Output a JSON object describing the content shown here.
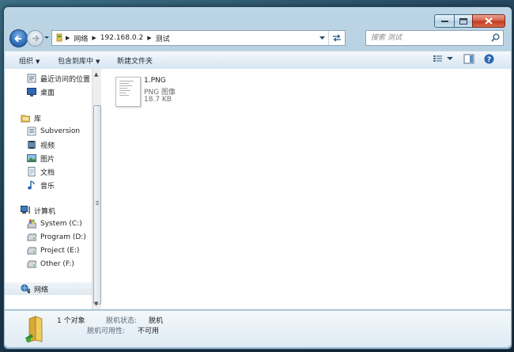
{
  "window": {
    "caption": {
      "minimize": "minimize",
      "maximize": "maximize",
      "close": "close"
    }
  },
  "address": {
    "crumbs": [
      "网络",
      "192.168.0.2",
      "测试"
    ]
  },
  "search": {
    "placeholder": "搜索 测试"
  },
  "toolbar": {
    "organize": "组织",
    "include_in_library": "包含到库中",
    "new_folder": "新建文件夹"
  },
  "nav": {
    "favorites": [
      {
        "label": "最近访问的位置",
        "icon": "recent-places-icon"
      },
      {
        "label": "桌面",
        "icon": "desktop-icon"
      }
    ],
    "libraries_header": "库",
    "libraries": [
      {
        "label": "Subversion",
        "icon": "library-icon"
      },
      {
        "label": "视频",
        "icon": "video-icon"
      },
      {
        "label": "图片",
        "icon": "pictures-icon"
      },
      {
        "label": "文档",
        "icon": "documents-icon"
      },
      {
        "label": "音乐",
        "icon": "music-icon"
      }
    ],
    "computer_header": "计算机",
    "drives": [
      {
        "label": "System (C:)"
      },
      {
        "label": "Program (D:)"
      },
      {
        "label": "Project (E:)"
      },
      {
        "label": "Other (F:)"
      }
    ],
    "network_header": "网络"
  },
  "files": [
    {
      "name": "1.PNG",
      "type": "PNG 图像",
      "size": "18.7 KB"
    }
  ],
  "details": {
    "count": "1 个对象",
    "offline_status_label": "脱机状态:",
    "offline_status_value": "脱机",
    "offline_availability_label": "脱机可用性:",
    "offline_availability_value": "不可用"
  },
  "colors": {
    "accent": "#2e6fb9",
    "close_red": "#c2381c"
  }
}
